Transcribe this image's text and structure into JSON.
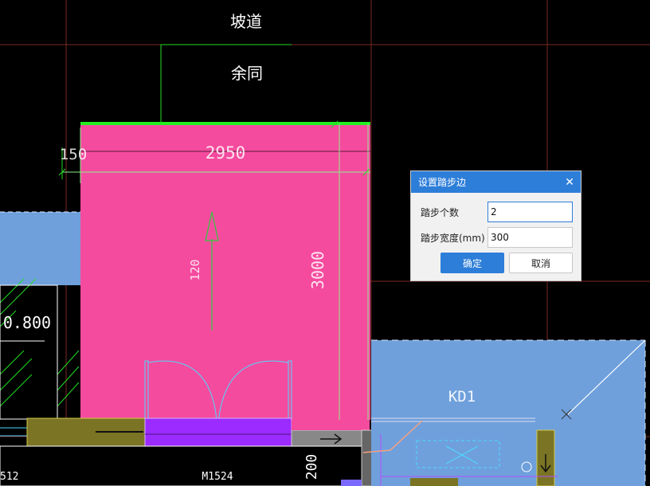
{
  "drawing": {
    "labels": {
      "ramp": "坡道",
      "remaining": "余同",
      "dim_150": "150",
      "dim_2950": "2950",
      "dim_3000": "3000",
      "dim_120": "120",
      "elevation": "0.800",
      "zone": "KD1",
      "door": "M1524",
      "dim_200": "200",
      "edge_512": "512"
    },
    "colors": {
      "background": "#000000",
      "ramp_fill": "#f54b9e",
      "slab_fill": "#6fa0dc",
      "axis_line": "#7a2a24",
      "green": "#22dd22",
      "door_purple": "#9b2bff",
      "olive": "#7a7424"
    }
  },
  "dialog": {
    "title": "设置踏步边",
    "close_icon": "close-icon",
    "step_count_label": "踏步个数",
    "step_count_value": "2",
    "step_width_label": "踏步宽度(mm)",
    "step_width_value": "300",
    "ok_label": "确定",
    "cancel_label": "取消"
  }
}
